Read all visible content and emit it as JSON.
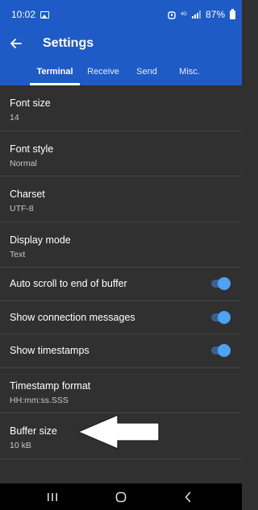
{
  "status": {
    "time": "10:02",
    "network": "4G",
    "battery": "87%"
  },
  "appbar": {
    "title": "Settings"
  },
  "tabs": [
    {
      "label": "Terminal",
      "active": true
    },
    {
      "label": "Receive",
      "active": false
    },
    {
      "label": "Send",
      "active": false
    },
    {
      "label": "Misc.",
      "active": false
    }
  ],
  "settings": {
    "font_size": {
      "label": "Font size",
      "value": "14"
    },
    "font_style": {
      "label": "Font style",
      "value": "Normal"
    },
    "charset": {
      "label": "Charset",
      "value": "UTF-8"
    },
    "display_mode": {
      "label": "Display mode",
      "value": "Text"
    },
    "auto_scroll": {
      "label": "Auto scroll to end of buffer",
      "enabled": true
    },
    "show_connection_messages": {
      "label": "Show connection messages",
      "enabled": true
    },
    "show_timestamps": {
      "label": "Show timestamps",
      "enabled": true
    },
    "timestamp_format": {
      "label": "Timestamp format",
      "value": "HH:mm:ss.SSS"
    },
    "buffer_size": {
      "label": "Buffer size",
      "value": "10 kB"
    }
  },
  "colors": {
    "primary": "#1e5bc6",
    "background": "#303030",
    "switch_thumb": "#4da3f5",
    "switch_track": "#3a5f93"
  }
}
